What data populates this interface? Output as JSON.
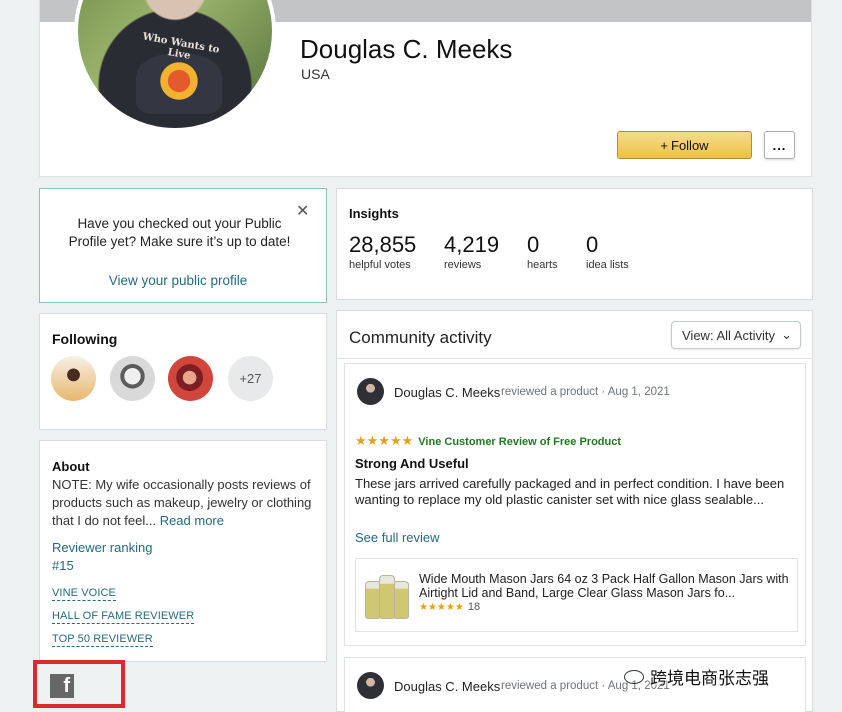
{
  "profile": {
    "name": "Douglas C. Meeks",
    "country": "USA",
    "avatar_shirt_text": "Who Wants to Live",
    "follow_label": "Follow",
    "more_label": "..."
  },
  "notice": {
    "text": "Have you checked out your Public Profile yet? Make sure it’s up to date!",
    "link": "View your public profile"
  },
  "following": {
    "title": "Following",
    "more_count": "+27"
  },
  "about": {
    "title": "About",
    "text": "NOTE: My wife occasionally posts reviews of products such as makeup, jewelry or clothing that I do not feel... ",
    "read_more": "Read more",
    "ranking_label": "Reviewer ranking",
    "ranking_value": "#15",
    "badges": [
      "VINE VOICE",
      "HALL OF FAME REVIEWER",
      "TOP 50 REVIEWER"
    ]
  },
  "insights": {
    "title": "Insights",
    "stats": [
      {
        "value": "28,855",
        "label": "helpful votes"
      },
      {
        "value": "4,219",
        "label": "reviews"
      },
      {
        "value": "0",
        "label": "hearts"
      },
      {
        "value": "0",
        "label": "idea lists"
      }
    ]
  },
  "community": {
    "title": "Community activity",
    "filter_label": "View: All Activity",
    "review": {
      "author": "Douglas C. Meeks",
      "meta": "reviewed a product · Aug 1, 2021",
      "vine_label": "Vine Customer Review of Free Product",
      "rating": 5,
      "title": "Strong And Useful",
      "body_line1": "These jars arrived carefully packaged and in perfect condition. I have been",
      "body_line2": "wanting to replace my old plastic canister set with nice glass sealable...",
      "see_more": "See full review",
      "product_title": "Wide Mouth Mason Jars 64 oz 3 Pack Half Gallon Mason Jars with Airtight Lid and Band, Large Clear Glass Mason Jars fo...",
      "product_rating_count": "18"
    },
    "review2": {
      "author": "Douglas C. Meeks",
      "meta": "reviewed a product · Aug 1, 2021"
    }
  },
  "watermark": "跨境电商张志强",
  "colors": {
    "link": "#236b80",
    "follow_button": "#eec143",
    "vine_green": "#1f7a1f",
    "star": "#e5a116",
    "highlight_box": "#d82b2b"
  },
  "icons": [
    "facebook-icon",
    "close-icon",
    "chevron-down-icon",
    "plus-icon",
    "star-icon",
    "wechat-icon"
  ]
}
